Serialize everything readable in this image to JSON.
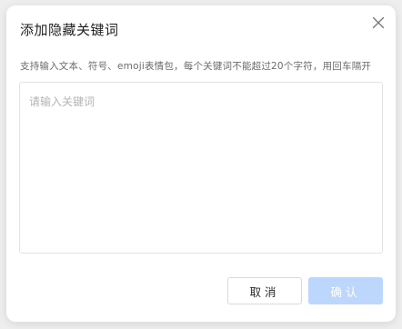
{
  "dialog": {
    "title": "添加隐藏关键词",
    "close_icon": "close-icon",
    "description": "支持输入文本、符号、emoji表情包，每个关键词不能超过20个字符，用回车隔开",
    "input": {
      "value": "",
      "placeholder": "请输入关键词"
    },
    "cancel_label": "取消",
    "confirm_label": "确认"
  },
  "colors": {
    "confirm_disabled_bg": "#bcd7fb",
    "border": "#e3e3e3",
    "placeholder": "#b3b3b3"
  }
}
